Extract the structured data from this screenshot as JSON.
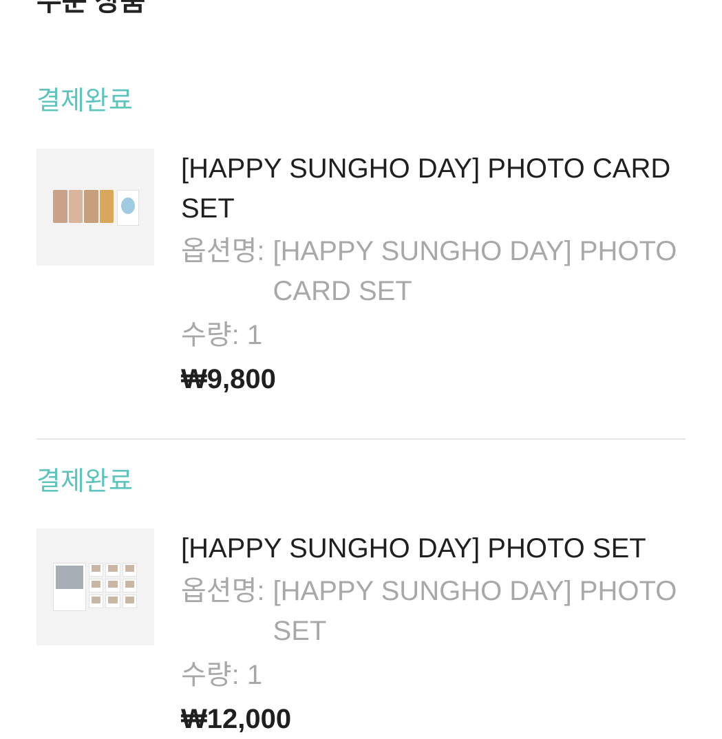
{
  "page": {
    "title": "주문 상품"
  },
  "orders": [
    {
      "status": "결제완료",
      "product_name": "[HAPPY SUNGHO DAY] PHOTO CARD SET",
      "option_label": "옵션명:",
      "option_value": "[HAPPY SUNGHO DAY] PHOTO CARD SET",
      "quantity_label": "수량: 1",
      "price": "₩9,800"
    },
    {
      "status": "결제완료",
      "product_name": "[HAPPY SUNGHO DAY] PHOTO SET",
      "option_label": "옵션명:",
      "option_value": "[HAPPY SUNGHO DAY] PHOTO SET",
      "quantity_label": "수량: 1",
      "price": "₩12,000"
    }
  ],
  "colors": {
    "status": "#5cc4bd",
    "muted_text": "#a8a8a8",
    "primary_text": "#1f1f1f",
    "thumbnail_bg": "#f3f3f3",
    "divider": "#e6e6e6"
  },
  "icons": {
    "thumbnail_1": "photo-card-set-image",
    "thumbnail_2": "photo-set-image"
  }
}
